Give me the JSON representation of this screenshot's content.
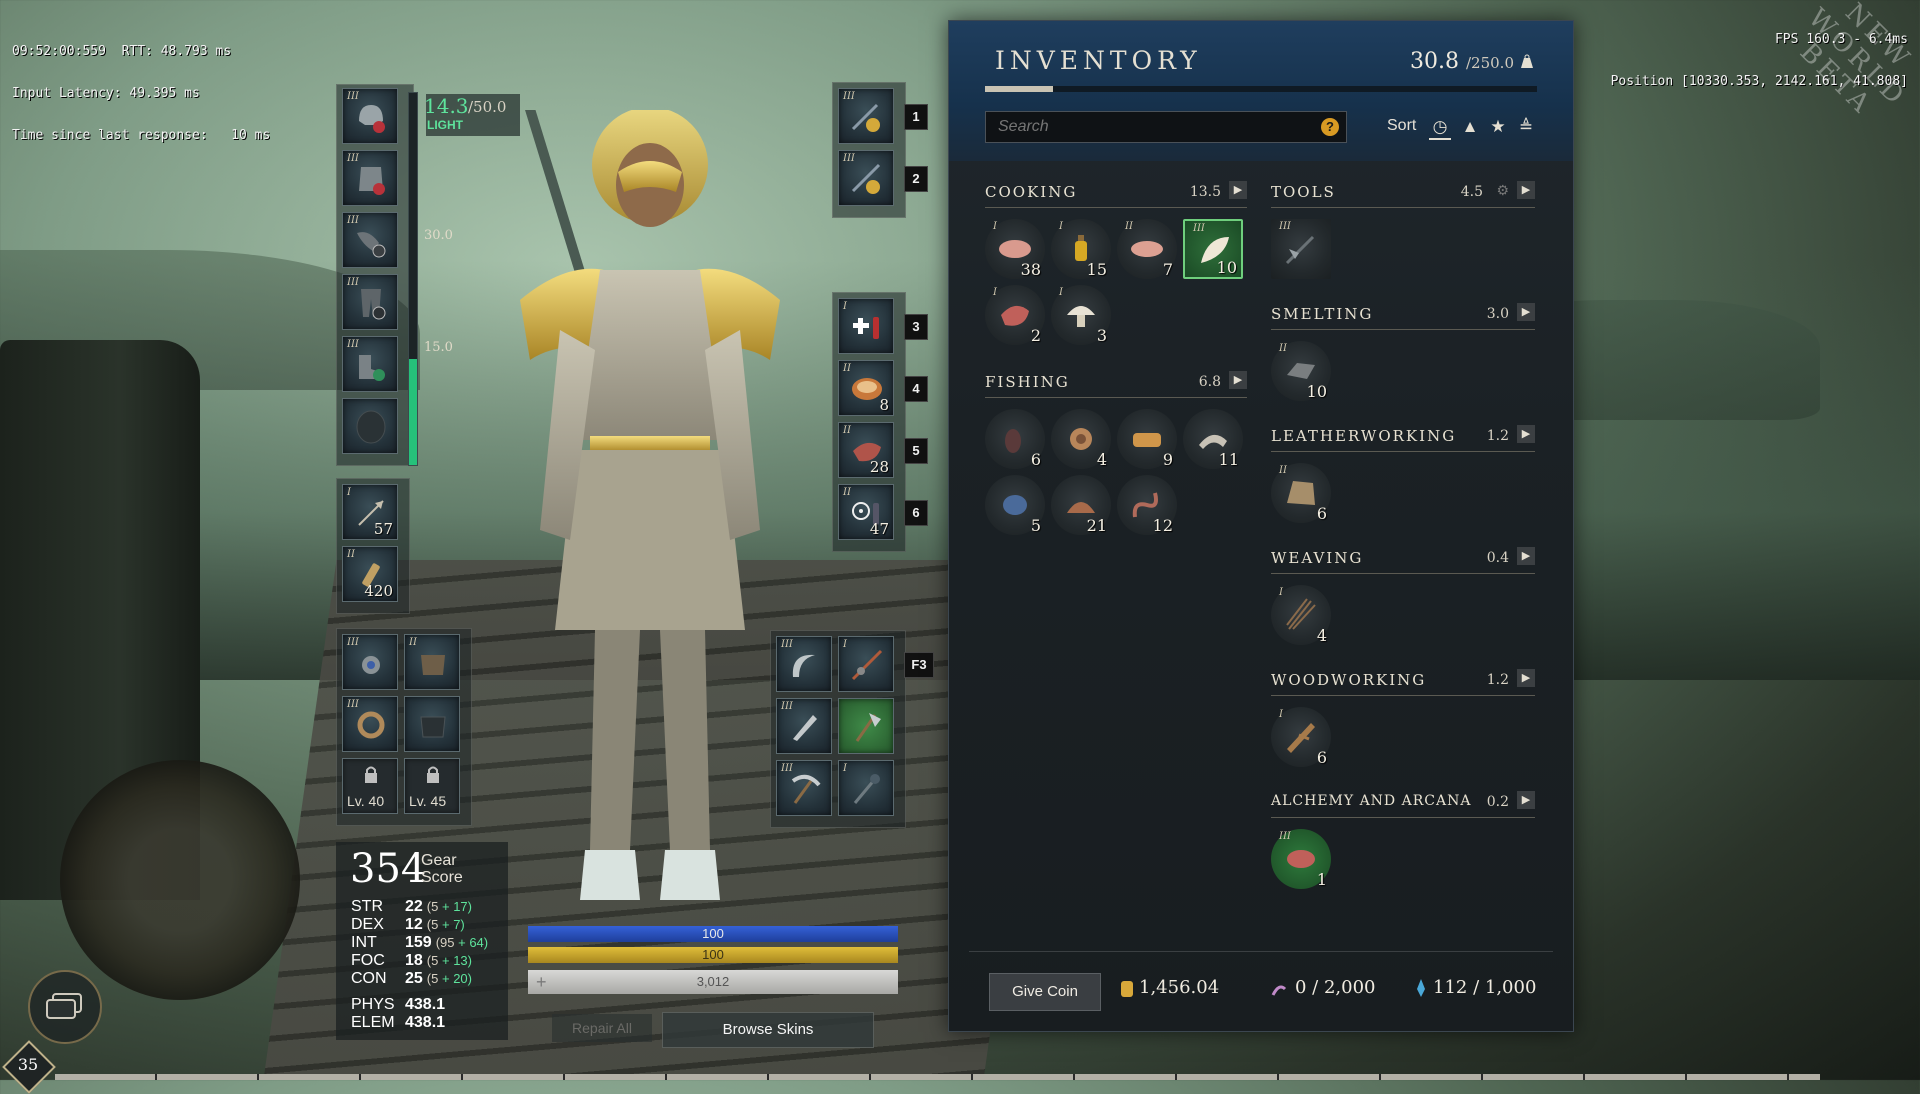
{
  "debug": {
    "left_lines": [
      "09:52:00:559  RTT: 48.793 ms",
      "Input Latency: 49.395 ms",
      "Time since last response:   10 ms"
    ],
    "right_lines": [
      "FPS 160.3 - 6.4ms",
      "Position [10330.353, 2142.161, 41.808]"
    ]
  },
  "watermark": "NEW WORLD BETA",
  "equip_weight": {
    "current": "14.3",
    "max": "/50.0",
    "class": "LIGHT",
    "fill_fraction": 0.286,
    "tick_30": "30.0",
    "tick_15": "15.0"
  },
  "armor_slots": [
    {
      "name": "head-armor-slot",
      "tier": "III",
      "icon": "helmet-icon"
    },
    {
      "name": "chest-armor-slot",
      "tier": "III",
      "icon": "chest-armor-icon"
    },
    {
      "name": "gloves-armor-slot",
      "tier": "III",
      "icon": "gloves-icon"
    },
    {
      "name": "legs-armor-slot",
      "tier": "III",
      "icon": "legs-armor-icon"
    },
    {
      "name": "feet-armor-slot",
      "tier": "III",
      "icon": "boots-icon"
    },
    {
      "name": "shield-armor-slot",
      "tier": "",
      "icon": "shield-icon"
    }
  ],
  "ammo_slots": [
    {
      "tier": "I",
      "count": "57",
      "icon": "arrow-icon"
    },
    {
      "tier": "II",
      "count": "420",
      "icon": "cartridge-icon"
    }
  ],
  "jewelry_slots": [
    {
      "tier": "III",
      "icon": "amulet-icon"
    },
    {
      "tier": "II",
      "icon": "bag-icon"
    },
    {
      "tier": "III",
      "icon": "ring-icon"
    },
    {
      "tier": "",
      "icon": "bag-empty-icon"
    }
  ],
  "locked_slots": [
    "Lv. 40",
    "Lv. 45"
  ],
  "weapon_slots": [
    {
      "key": "1",
      "tier": "III",
      "icon": "weapon-1-icon"
    },
    {
      "key": "2",
      "tier": "III",
      "icon": "weapon-2-icon"
    }
  ],
  "quick_slots": [
    {
      "key": "3",
      "tier": "I",
      "count": "",
      "icon": "health-potion-icon"
    },
    {
      "key": "4",
      "tier": "II",
      "count": "8",
      "icon": "food-bowl-icon"
    },
    {
      "key": "5",
      "tier": "II",
      "count": "28",
      "icon": "meat-icon"
    },
    {
      "key": "6",
      "tier": "II",
      "count": "47",
      "icon": "coating-icon"
    }
  ],
  "tool_slots": [
    {
      "tier": "III",
      "icon": "sickle-icon"
    },
    {
      "tier": "I",
      "icon": "fishing-pole-icon"
    },
    {
      "tier": "III",
      "icon": "skinning-knife-icon"
    },
    {
      "tier": "",
      "icon": "axe-icon"
    },
    {
      "tier": "III",
      "icon": "pickaxe-icon"
    },
    {
      "tier": "I",
      "icon": "azoth-staff-icon"
    }
  ],
  "tool_keybind": "F3",
  "gear_score": {
    "value": "354",
    "label": "Gear Score"
  },
  "stats": [
    {
      "name": "STR",
      "value": "22",
      "base": "(5",
      "bonus": "+ 17)"
    },
    {
      "name": "DEX",
      "value": "12",
      "base": "(5",
      "bonus": "+ 7)"
    },
    {
      "name": "INT",
      "value": "159",
      "base": "(95",
      "bonus": "+ 64)"
    },
    {
      "name": "FOC",
      "value": "18",
      "base": "(5",
      "bonus": "+ 13)"
    },
    {
      "name": "CON",
      "value": "25",
      "base": "(5",
      "bonus": "+ 20)"
    }
  ],
  "defense": [
    {
      "name": "PHYS",
      "value": "438.1"
    },
    {
      "name": "ELEM",
      "value": "438.1"
    }
  ],
  "bars": {
    "mana": "100",
    "stamina": "100",
    "health": "3,012"
  },
  "buttons": {
    "repair_all": "Repair All",
    "browse_skins": "Browse Skins",
    "give_coin": "Give Coin"
  },
  "level": "35",
  "inventory": {
    "title": "INVENTORY",
    "weight_current": "30.8",
    "weight_max": "/250.0",
    "weight_fraction": 0.123,
    "search_placeholder": "Search",
    "sort_label": "Sort",
    "categories": {
      "cooking": {
        "name": "COOKING",
        "weight": "13.5"
      },
      "fishing": {
        "name": "FISHING",
        "weight": "6.8"
      },
      "tools": {
        "name": "TOOLS",
        "weight": "4.5"
      },
      "smelting": {
        "name": "SMELTING",
        "weight": "3.0"
      },
      "leatherworking": {
        "name": "LEATHERWORKING",
        "weight": "1.2"
      },
      "weaving": {
        "name": "WEAVING",
        "weight": "0.4"
      },
      "woodworking": {
        "name": "WOODWORKING",
        "weight": "1.2"
      },
      "alchemy": {
        "name": "ALCHEMY AND ARCANA",
        "weight": "0.2"
      }
    },
    "cooking_items": [
      {
        "tier": "I",
        "count": "38",
        "icon": "raw-fish-icon"
      },
      {
        "tier": "I",
        "count": "15",
        "icon": "oil-bottle-icon"
      },
      {
        "tier": "II",
        "count": "7",
        "icon": "fish-fillet-icon"
      },
      {
        "tier": "III",
        "count": "10",
        "icon": "fish-icon",
        "selected": true
      },
      {
        "tier": "I",
        "count": "2",
        "icon": "raw-meat-icon"
      },
      {
        "tier": "I",
        "count": "3",
        "icon": "mushroom-icon"
      }
    ],
    "fishing_items": [
      {
        "count": "6",
        "icon": "bait-grub-icon"
      },
      {
        "count": "4",
        "icon": "bait-snail-icon"
      },
      {
        "count": "9",
        "icon": "bait-bread-icon"
      },
      {
        "count": "11",
        "icon": "bait-shrimp-icon"
      },
      {
        "count": "5",
        "icon": "bait-beetle-icon"
      },
      {
        "count": "21",
        "icon": "bait-shell-icon"
      },
      {
        "count": "12",
        "icon": "bait-worm-icon"
      }
    ],
    "tools_items": [
      {
        "tier": "III",
        "count": "",
        "icon": "hatchet-tool-icon"
      }
    ],
    "smelting_items": [
      {
        "tier": "II",
        "count": "10",
        "icon": "iron-ingot-icon"
      }
    ],
    "leatherworking_items": [
      {
        "tier": "II",
        "count": "6",
        "icon": "leather-icon"
      }
    ],
    "weaving_items": [
      {
        "tier": "I",
        "count": "4",
        "icon": "fiber-icon"
      }
    ],
    "woodworking_items": [
      {
        "tier": "I",
        "count": "6",
        "icon": "green-wood-icon"
      }
    ],
    "alchemy_items": [
      {
        "tier": "III",
        "count": "1",
        "icon": "salmon-icon"
      }
    ],
    "coin": "1,456.04",
    "azoth": "0 / 2,000",
    "faction": "112 / 1,000"
  }
}
